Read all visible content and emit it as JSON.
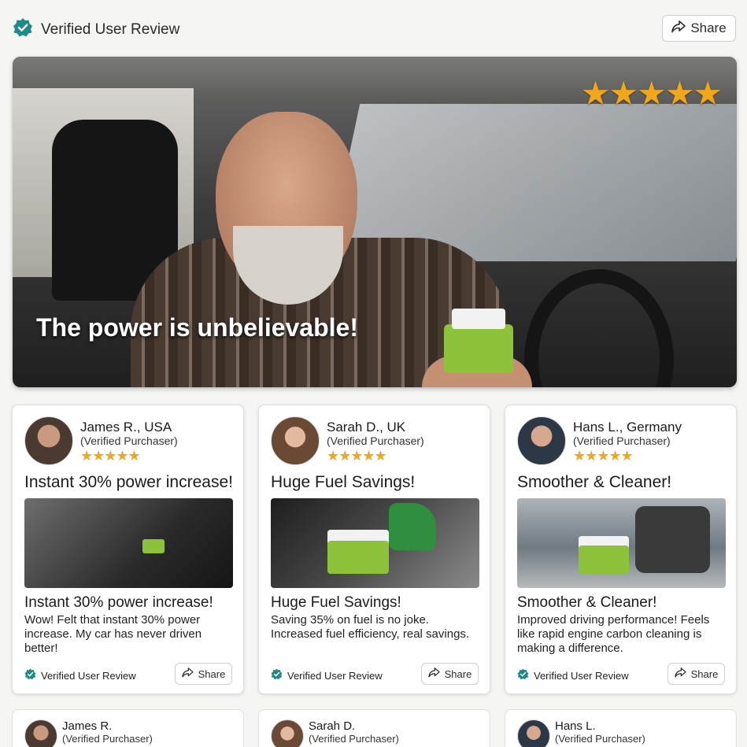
{
  "header": {
    "title": "Verified User Review",
    "share_label": "Share",
    "badge_icon": "verified-badge-icon",
    "share_icon": "share-arrow-icon",
    "accent_color": "#1f8a8a"
  },
  "hero": {
    "rating_stars": 5,
    "stars_text": "★★★★★",
    "caption": "The power is unbelievable!",
    "star_color": "#f2a61a"
  },
  "reviews": [
    {
      "name": "James R., USA",
      "status": "(Verified Purchaser)",
      "stars_text": "★★★★★",
      "headline": "Instant 30% power increase!",
      "title": "Instant 30% power increase!",
      "body": "Wow! Felt that instant 30% power increase. My car has never driven better!",
      "verified_label": "Verified User Review",
      "share_label": "Share"
    },
    {
      "name": "Sarah D., UK",
      "status": "(Verified Purchaser)",
      "stars_text": "★★★★★",
      "headline": "Huge Fuel Savings!",
      "title": "Huge Fuel Savings!",
      "body": "Saving 35% on fuel is no joke. Increased fuel efficiency, real savings.",
      "verified_label": "Verified User Review",
      "share_label": "Share"
    },
    {
      "name": "Hans L., Germany",
      "status": "(Verified Purchaser)",
      "stars_text": "★★★★★",
      "headline": "Smoother & Cleaner!",
      "title": "Smoother & Cleaner!",
      "body": "Improved driving performance! Feels like rapid engine carbon cleaning is making a difference.",
      "verified_label": "Verified User Review",
      "share_label": "Share"
    }
  ],
  "reviews_row2": [
    {
      "name": "James R.",
      "status": "(Verified Purchaser)"
    },
    {
      "name": "Sarah D.",
      "status": "(Verified Purchaser)"
    },
    {
      "name": "Hans L.",
      "status": "(Verified Purchaser)"
    }
  ]
}
